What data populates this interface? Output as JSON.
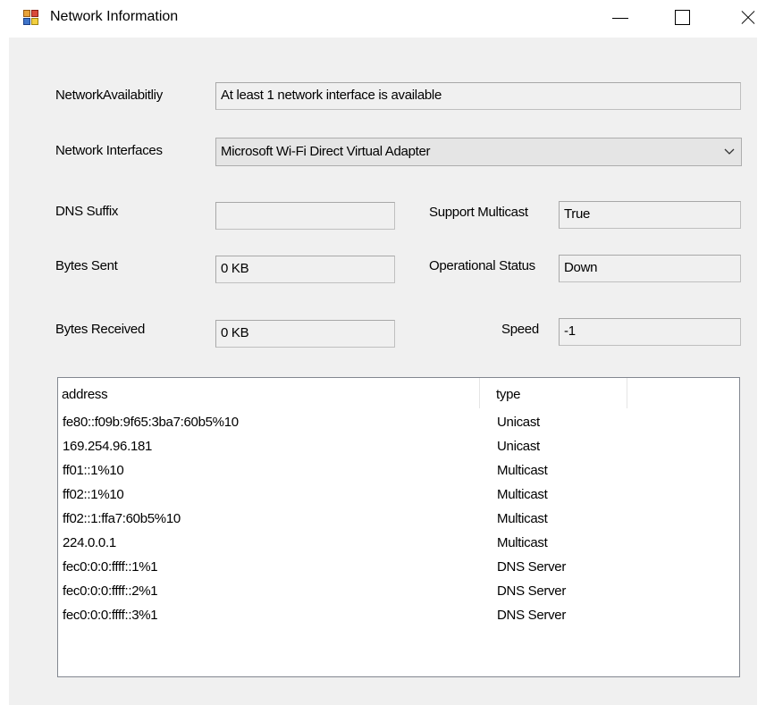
{
  "window": {
    "title": "Network Information"
  },
  "form": {
    "network_availability": {
      "label": "NetworkAvailabitliy",
      "value": "At least 1 network interface is available"
    },
    "network_interfaces": {
      "label": "Network Interfaces",
      "selected": "Microsoft Wi-Fi Direct Virtual Adapter"
    },
    "dns_suffix": {
      "label": "DNS Suffix",
      "value": ""
    },
    "bytes_sent": {
      "label": "Bytes Sent",
      "value": "0 KB"
    },
    "bytes_received": {
      "label": "Bytes Received",
      "value": "0 KB"
    },
    "support_multicast": {
      "label": "Support Multicast",
      "value": "True"
    },
    "operational_status": {
      "label": "Operational Status",
      "value": "Down"
    },
    "speed": {
      "label": "Speed",
      "value": "-1"
    }
  },
  "addresses": {
    "columns": {
      "address": "address",
      "type": "type"
    },
    "rows": [
      {
        "address": "fe80::f09b:9f65:3ba7:60b5%10",
        "type": "Unicast"
      },
      {
        "address": "169.254.96.181",
        "type": "Unicast"
      },
      {
        "address": "ff01::1%10",
        "type": "Multicast"
      },
      {
        "address": "ff02::1%10",
        "type": "Multicast"
      },
      {
        "address": "ff02::1:ffa7:60b5%10",
        "type": "Multicast"
      },
      {
        "address": "224.0.0.1",
        "type": "Multicast"
      },
      {
        "address": "fec0:0:0:ffff::1%1",
        "type": "DNS Server"
      },
      {
        "address": "fec0:0:0:ffff::2%1",
        "type": "DNS Server"
      },
      {
        "address": "fec0:0:0:ffff::3%1",
        "type": "DNS Server"
      }
    ]
  }
}
